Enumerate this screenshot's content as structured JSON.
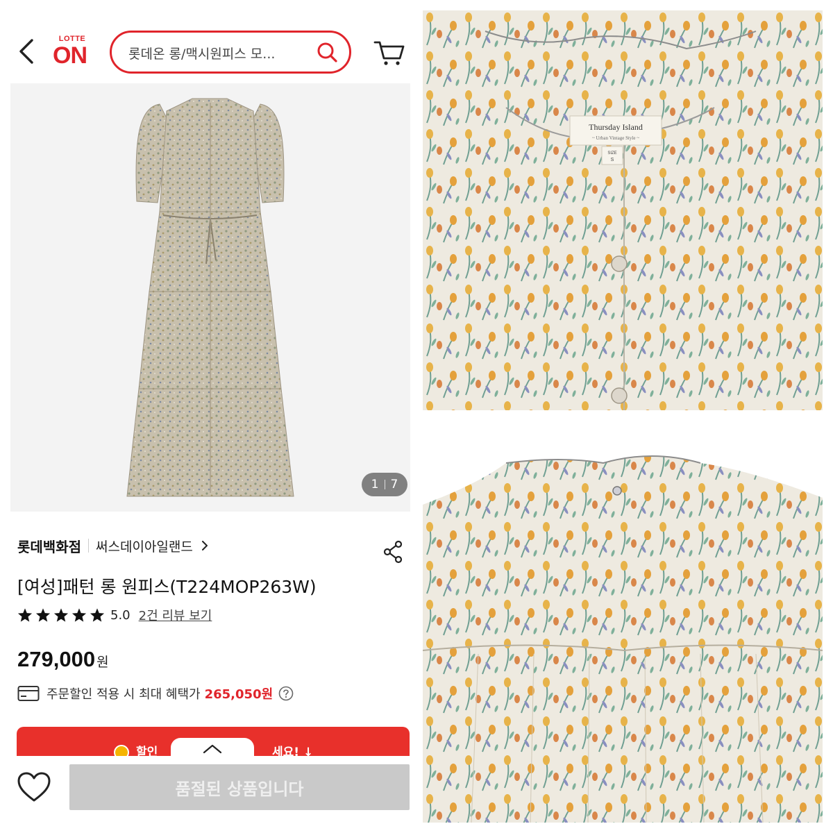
{
  "header": {
    "logo_top": "LOTTE",
    "logo_main": "ON",
    "search_value": "롯데온 롱/맥시원피스 모..."
  },
  "gallery": {
    "current": "1",
    "total": "7"
  },
  "product": {
    "store": "롯데백화점",
    "brand": "써스데이아일랜드",
    "title": "[여성]패턴 롱 원피스(T224MOP263W)",
    "rating": "5.0",
    "stars": 5,
    "review_link": "2건 리뷰 보기",
    "price": "279,000",
    "price_unit": "원",
    "benefit_text": "주문할인 적용 시 최대 혜택가",
    "benefit_price": "265,050원"
  },
  "coupon": {
    "left_text": "할인",
    "right_text": "세요! ↓"
  },
  "bottom": {
    "soldout_label": "품절된 상품입니다"
  },
  "photos": {
    "label_brand": "Thursday Island",
    "label_tagline": "~ Urban Vintage Style ~",
    "size_label": "SIZE",
    "size_value": "S"
  },
  "colors": {
    "accent": "#e0242b",
    "coupon_bg": "#e8302b",
    "soldout_bg": "#c9c9c9"
  },
  "icons": [
    "chevron-left-icon",
    "search-icon",
    "cart-icon",
    "chevron-right-icon",
    "share-icon",
    "star-icon",
    "card-icon",
    "help-icon",
    "coin-icon",
    "chevron-up-icon",
    "heart-icon"
  ]
}
